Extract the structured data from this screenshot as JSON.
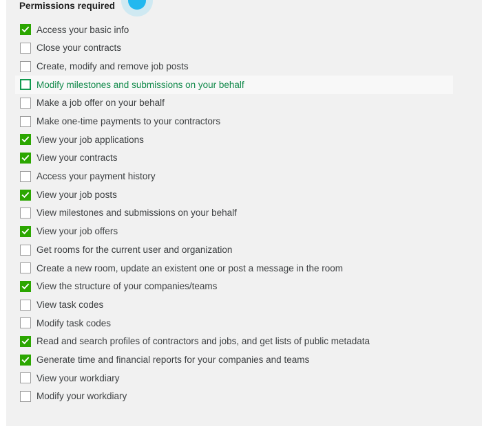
{
  "header": {
    "title": "Permissions required",
    "cursor_icon": "click-indicator-icon",
    "cursor_color": "#22b8ef",
    "cursor_halo_color": "#cfe9f2"
  },
  "colors": {
    "page_background": "#f1f1f1",
    "checked_checkbox": "#2ba600",
    "unchecked_border": "#9b9b9b",
    "highlight_row_background": "#f8f8f8",
    "highlight_row_text": "#128a4b",
    "highlight_checkbox_border": "#119a4f",
    "label_text": "#3c3f41",
    "title_text": "#1f1f1f"
  },
  "permissions": [
    {
      "label": "Access your basic info",
      "checked": true,
      "highlighted": false
    },
    {
      "label": "Close your contracts",
      "checked": false,
      "highlighted": false
    },
    {
      "label": "Create, modify and remove job posts",
      "checked": false,
      "highlighted": false
    },
    {
      "label": "Modify milestones and submissions on your behalf",
      "checked": false,
      "highlighted": true
    },
    {
      "label": "Make a job offer on your behalf",
      "checked": false,
      "highlighted": false
    },
    {
      "label": "Make one-time payments to your contractors",
      "checked": false,
      "highlighted": false
    },
    {
      "label": "View your job applications",
      "checked": true,
      "highlighted": false
    },
    {
      "label": "View your contracts",
      "checked": true,
      "highlighted": false
    },
    {
      "label": "Access your payment history",
      "checked": false,
      "highlighted": false
    },
    {
      "label": "View your job posts",
      "checked": true,
      "highlighted": false
    },
    {
      "label": "View milestones and submissions on your behalf",
      "checked": false,
      "highlighted": false
    },
    {
      "label": "View your job offers",
      "checked": true,
      "highlighted": false
    },
    {
      "label": "Get rooms for the current user and organization",
      "checked": false,
      "highlighted": false
    },
    {
      "label": "Create a new room, update an existent one or post a message in the room",
      "checked": false,
      "highlighted": false
    },
    {
      "label": "View the structure of your companies/teams",
      "checked": true,
      "highlighted": false
    },
    {
      "label": "View task codes",
      "checked": false,
      "highlighted": false
    },
    {
      "label": "Modify task codes",
      "checked": false,
      "highlighted": false
    },
    {
      "label": "Read and search profiles of contractors and jobs, and get lists of public metadata",
      "checked": true,
      "highlighted": false
    },
    {
      "label": "Generate time and financial reports for your companies and teams",
      "checked": true,
      "highlighted": false
    },
    {
      "label": "View your workdiary",
      "checked": false,
      "highlighted": false
    },
    {
      "label": "Modify your workdiary",
      "checked": false,
      "highlighted": false
    }
  ]
}
